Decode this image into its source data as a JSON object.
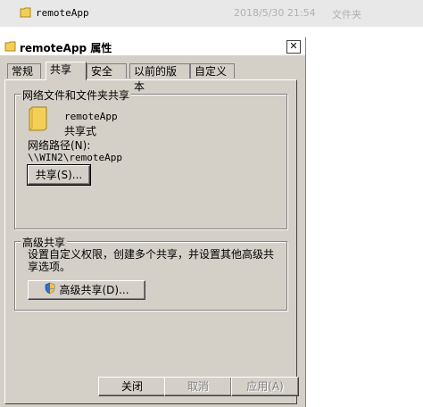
{
  "explorer_row": {
    "name": "remoteApp",
    "date": "2018/5/30 21:54",
    "type": "文件夹"
  },
  "dialog": {
    "title": "remoteApp 属性",
    "close_glyph": "✕",
    "tabs": [
      "常规",
      "共享",
      "安全",
      "以前的版本",
      "自定义"
    ],
    "active_tab": "共享",
    "network_group": {
      "label": "网络文件和文件夹共享",
      "share_name": "remoteApp",
      "share_type": "共享式",
      "path_label": "网络路径(N):",
      "path_value": "\\\\WIN2\\remoteApp",
      "share_button": "共享(S)..."
    },
    "advanced_group": {
      "label": "高级共享",
      "description": "设置自定义权限，创建多个共享，并设置其他高级共享选项。",
      "advanced_button": "高级共享(D)..."
    },
    "footer": {
      "close": "关闭",
      "cancel": "取消",
      "apply": "应用(A)"
    }
  },
  "icons": {
    "folder": "folder-icon",
    "shield": "uac-shield-icon"
  },
  "colors": {
    "dialog_bg": "#d4d0c8",
    "folder_yellow": "#f3cf55",
    "disabled_text": "#808080"
  }
}
